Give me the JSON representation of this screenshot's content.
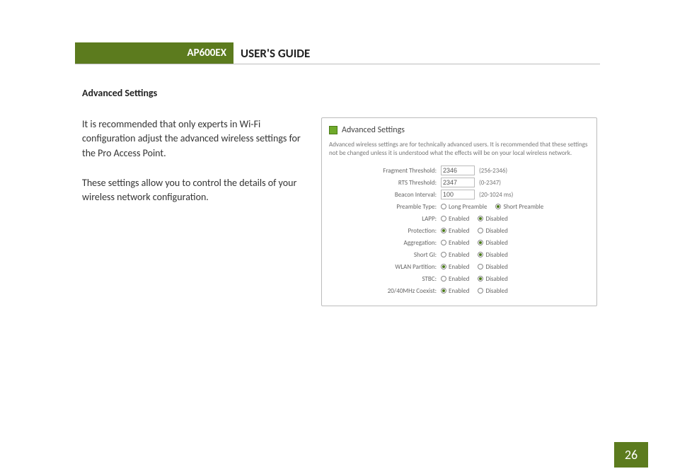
{
  "header": {
    "model": "AP600EX",
    "title": "USER'S GUIDE"
  },
  "section_heading": "Advanced Settings",
  "body": {
    "p1": "It is recommended that only experts in Wi-Fi configuration adjust the advanced wireless settings for the Pro Access Point.",
    "p2": "These settings allow you to control the details of your wireless network configuration."
  },
  "panel": {
    "title": "Advanced Settings",
    "description": "Advanced wireless settings are for technically advanced users. It is recommended that these settings not be changed unless it is understood what the effects will be on your local wireless network.",
    "rows": {
      "fragment": {
        "label": "Fragment Threshold:",
        "value": "2346",
        "hint": "(256-2346)"
      },
      "rts": {
        "label": "RTS Threshold:",
        "value": "2347",
        "hint": "(0-2347)"
      },
      "beacon": {
        "label": "Beacon Interval:",
        "value": "100",
        "hint": "(20-1024 ms)"
      },
      "preamble": {
        "label": "Preamble Type:",
        "opt1": "Long Preamble",
        "opt2": "Short Preamble",
        "selected": 2
      },
      "lapp": {
        "label": "LAPP:",
        "opt1": "Enabled",
        "opt2": "Disabled",
        "selected": 2
      },
      "protection": {
        "label": "Protection:",
        "opt1": "Enabled",
        "opt2": "Disabled",
        "selected": 1
      },
      "aggregation": {
        "label": "Aggregation:",
        "opt1": "Enabled",
        "opt2": "Disabled",
        "selected": 2
      },
      "shortgi": {
        "label": "Short GI:",
        "opt1": "Enabled",
        "opt2": "Disabled",
        "selected": 2
      },
      "wlanpart": {
        "label": "WLAN Partition:",
        "opt1": "Enabled",
        "opt2": "Disabled",
        "selected": 1
      },
      "stbc": {
        "label": "STBC:",
        "opt1": "Enabled",
        "opt2": "Disabled",
        "selected": 2
      },
      "coexist": {
        "label": "20/40MHz Coexist:",
        "opt1": "Enabled",
        "opt2": "Disabled",
        "selected": 1
      }
    }
  },
  "page_number": "26"
}
